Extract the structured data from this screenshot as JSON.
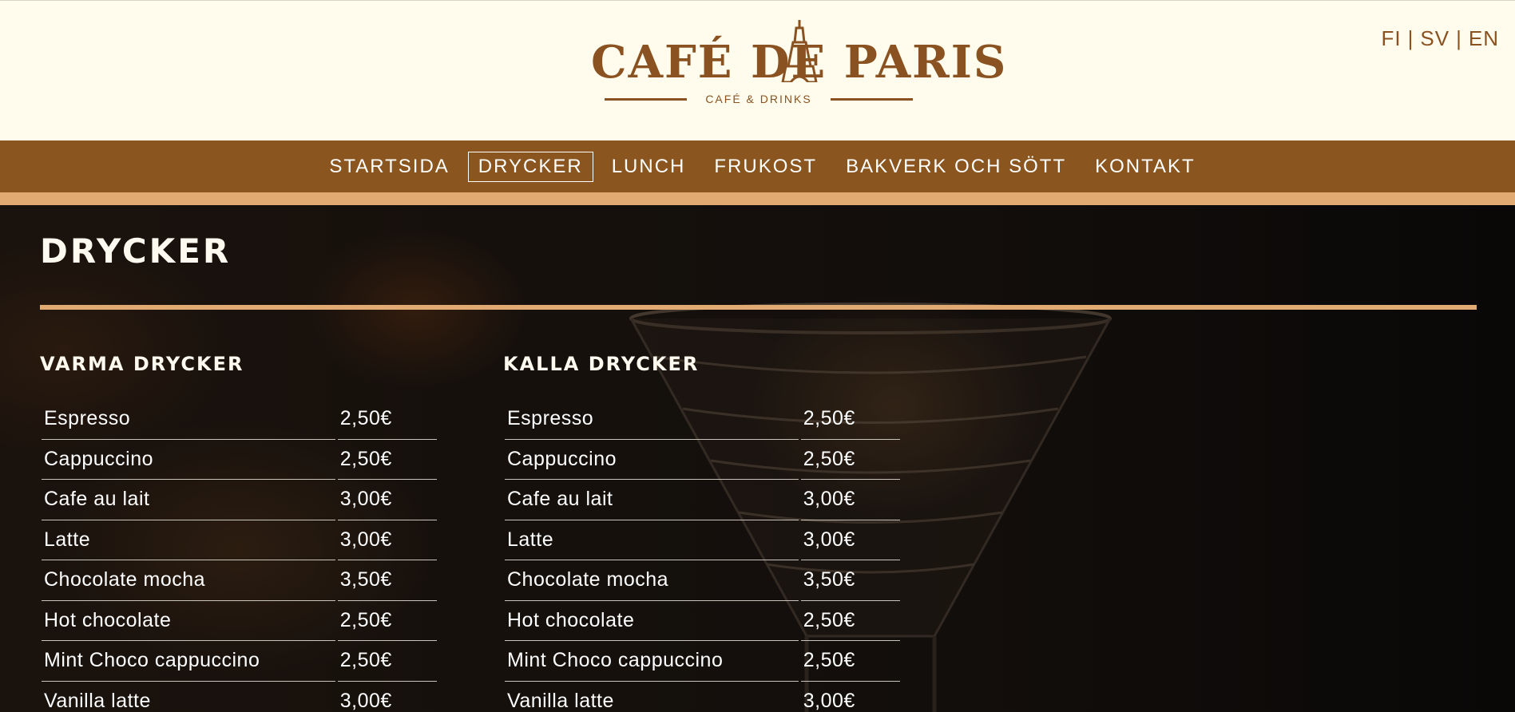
{
  "brand": {
    "logo_main": "CAFÉ DE PARIS",
    "logo_sub": "CAFÉ & DRINKS",
    "accent_brown": "#8a551e",
    "accent_tan": "#e2aa73",
    "header_bg": "#fffcee"
  },
  "languages": [
    "FI",
    "SV",
    "EN"
  ],
  "nav": {
    "items": [
      {
        "label": "STARTSIDA",
        "active": false
      },
      {
        "label": "DRYCKER",
        "active": true
      },
      {
        "label": "LUNCH",
        "active": false
      },
      {
        "label": "FRUKOST",
        "active": false
      },
      {
        "label": "BAKVERK OCH SÖTT",
        "active": false
      },
      {
        "label": "KONTAKT",
        "active": false
      }
    ]
  },
  "page": {
    "title": "DRYCKER"
  },
  "sections": [
    {
      "title": "VARMA DRYCKER",
      "rows": [
        {
          "name": "Espresso",
          "price": "2,50€"
        },
        {
          "name": "Cappuccino",
          "price": "2,50€"
        },
        {
          "name": "Cafe au lait",
          "price": "3,00€"
        },
        {
          "name": "Latte",
          "price": "3,00€"
        },
        {
          "name": "Chocolate mocha",
          "price": "3,50€"
        },
        {
          "name": "Hot chocolate",
          "price": "2,50€"
        },
        {
          "name": "Mint Choco cappuccino",
          "price": "2,50€"
        },
        {
          "name": "Vanilla latte",
          "price": "3,00€"
        }
      ]
    },
    {
      "title": "KALLA DRYCKER",
      "rows": [
        {
          "name": "Espresso",
          "price": "2,50€"
        },
        {
          "name": "Cappuccino",
          "price": "2,50€"
        },
        {
          "name": "Cafe au lait",
          "price": "3,00€"
        },
        {
          "name": "Latte",
          "price": "3,00€"
        },
        {
          "name": "Chocolate mocha",
          "price": "3,50€"
        },
        {
          "name": "Hot chocolate",
          "price": "2,50€"
        },
        {
          "name": "Mint Choco cappuccino",
          "price": "2,50€"
        },
        {
          "name": "Vanilla latte",
          "price": "3,00€"
        }
      ]
    }
  ]
}
